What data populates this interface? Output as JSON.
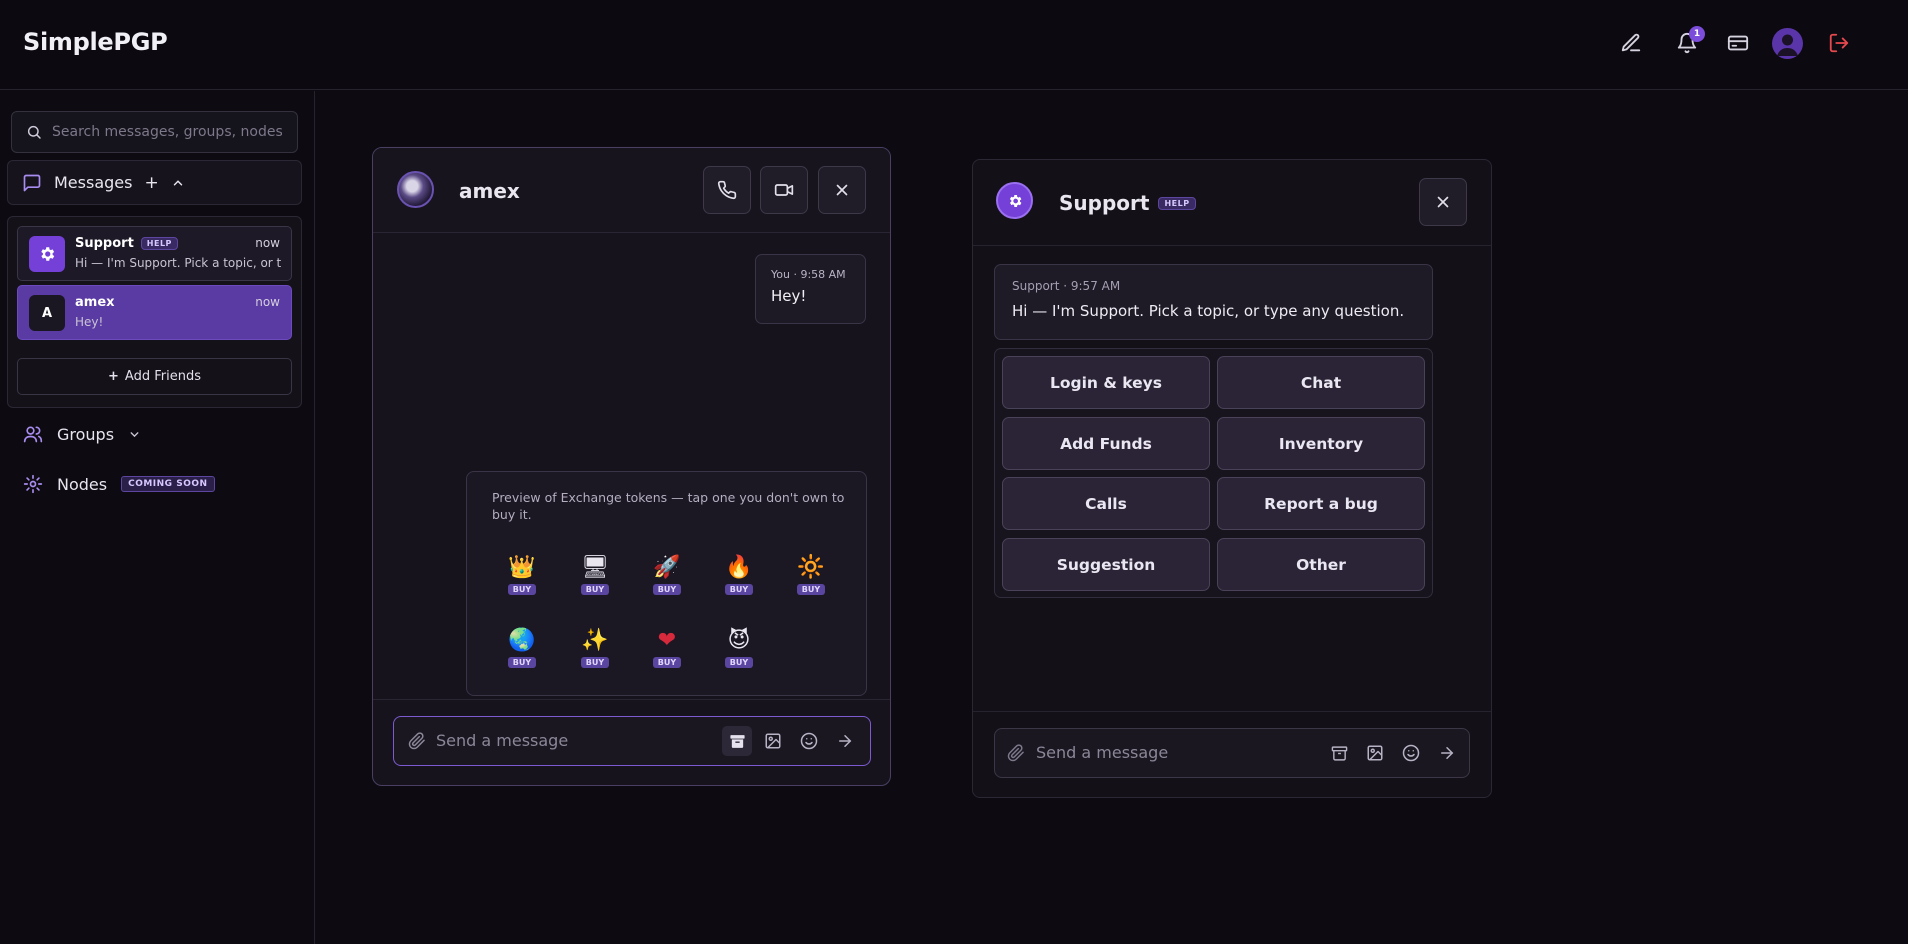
{
  "app": {
    "title": "SimplePGP",
    "notification_count": "1"
  },
  "colors": {
    "accent": "#7c4ddb",
    "logout": "#e5484d",
    "background": "#0d0b11"
  },
  "sidebar": {
    "search_placeholder": "Search messages, groups, nodes...",
    "messages_label": "Messages",
    "add_symbol": "+",
    "conversations": [
      {
        "name": "Support",
        "badge": "HELP",
        "time": "now",
        "preview": "Hi — I'm Support. Pick a topic, or type any question.",
        "avatar_icon": "gear-icon"
      },
      {
        "name": "amex",
        "initial": "A",
        "time": "now",
        "preview": "Hey!"
      }
    ],
    "add_friends_label": "Add Friends",
    "groups_label": "Groups",
    "nodes_label": "Nodes",
    "nodes_badge": "COMING SOON"
  },
  "chat_amex": {
    "name": "amex",
    "message": {
      "meta": "You · 9:58 AM",
      "text": "Hey!"
    },
    "token_panel": {
      "description": "Preview of Exchange tokens — tap one you don't own to buy it.",
      "buy_label": "BUY",
      "tokens": [
        {
          "icon": "crown-icon",
          "glyph": "👑"
        },
        {
          "icon": "computer-icon",
          "glyph": "🖥"
        },
        {
          "icon": "rocket-icon",
          "glyph": "🚀"
        },
        {
          "icon": "fire-icon",
          "glyph": "🔥"
        },
        {
          "icon": "sun-icon",
          "glyph": "🔆"
        },
        {
          "icon": "globe-icon",
          "glyph": "🌏"
        },
        {
          "icon": "stars-icon",
          "glyph": "✨"
        },
        {
          "icon": "heart-icon",
          "glyph": "❤"
        },
        {
          "icon": "devil-icon",
          "glyph": "😈"
        }
      ]
    },
    "composer_placeholder": "Send a message"
  },
  "chat_support": {
    "name": "Support",
    "badge": "HELP",
    "message": {
      "meta": "Support · 9:57 AM",
      "text": "Hi — I'm Support. Pick a topic, or type any question."
    },
    "topics": [
      "Login & keys",
      "Chat",
      "Add Funds",
      "Inventory",
      "Calls",
      "Report a bug",
      "Suggestion",
      "Other"
    ],
    "composer_placeholder": "Send a message"
  }
}
